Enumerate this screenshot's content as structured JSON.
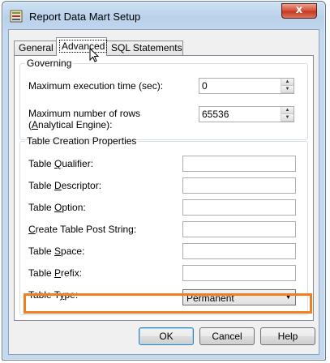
{
  "window": {
    "title": "Report Data Mart Setup",
    "close_glyph": "x"
  },
  "tabs": [
    {
      "label": "General",
      "active": false
    },
    {
      "label": "Advanced",
      "active": true
    },
    {
      "label": "SQL Statements",
      "active": false
    }
  ],
  "governing": {
    "legend": "Governing",
    "max_exec_time": {
      "prefix": "Maximum execution time (sec):",
      "value": "0"
    },
    "max_rows": {
      "prefix": "Maximum number of rows (",
      "mnemonic": "A",
      "suffix": "nalytical Engine):",
      "value": "65536"
    }
  },
  "table_creation": {
    "legend": "Table Creation Properties",
    "fields": [
      {
        "pre": "Table ",
        "mn": "Q",
        "post": "ualifier:",
        "value": ""
      },
      {
        "pre": "Table ",
        "mn": "D",
        "post": "escriptor:",
        "value": ""
      },
      {
        "pre": "Table ",
        "mn": "O",
        "post": "ption:",
        "value": ""
      },
      {
        "pre": "",
        "mn": "C",
        "post": "reate Table Post String:",
        "value": ""
      },
      {
        "pre": "Table ",
        "mn": "S",
        "post": "pace:",
        "value": ""
      },
      {
        "pre": "Table ",
        "mn": "P",
        "post": "refix:",
        "value": ""
      }
    ],
    "table_type": {
      "pre": "Table T",
      "mn": "y",
      "post": "pe:",
      "value": "Permanent"
    }
  },
  "buttons": {
    "ok": "OK",
    "cancel": "Cancel",
    "help": "Help"
  },
  "colors": {
    "highlight": "#f07f22"
  }
}
